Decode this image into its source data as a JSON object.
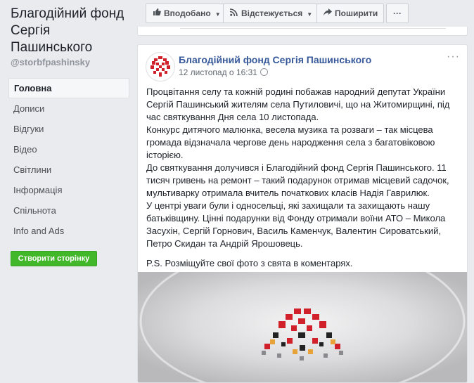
{
  "sidebar": {
    "page_name": "Благодійний фонд Сергія Пашинського",
    "handle": "@storbfpashinsky",
    "items": [
      {
        "label": "Головна"
      },
      {
        "label": "Дописи"
      },
      {
        "label": "Відгуки"
      },
      {
        "label": "Відео"
      },
      {
        "label": "Світлини"
      },
      {
        "label": "Інформація"
      },
      {
        "label": "Спільнота"
      },
      {
        "label": "Info and Ads"
      }
    ],
    "create_page_label": "Створити сторінку"
  },
  "toolbar": {
    "liked_label": "Вподобано",
    "following_label": "Відстежується",
    "share_label": "Поширити",
    "more_label": "···"
  },
  "post": {
    "author": "Благодійний фонд Сергія Пашинського",
    "timestamp": "12 листопад о 16:31",
    "paragraphs": [
      "Процвітання селу та кожній родині побажав народний депутат України Сергій Пашинський жителям села Путиловичі, що на Житомирщині, під час святкування Дня села 10 листопада.",
      "Конкурс дитячого малюнка, весела музика та розваги – так місцева громада відзначала чергове день народження села з багатовіковою історією.",
      "До святкування долучився і Благодійний фонд Сергія Пашинського. 11 тисяч гривень на ремонт – такий подарунок отримав місцевий садочок, мультиварку отримала вчитель початкових класів Надія Гаврилюк.",
      "У центрі уваги були і односельці, які захищали та захищають нашу батьківщину. Цінні подарунки від Фонду отримали воїни АТО – Микола Засухін, Сергій Горнович, Василь Каменчук, Валентин Сироватський, Петро Скидан та Андрій Ярошовець."
    ],
    "ps": "P.S. Розміщуйте свої фото з свята в коментарях.",
    "more_label": "···"
  },
  "colors": {
    "link": "#365899",
    "create_button": "#42b72a",
    "logo_red": "#d0202a"
  }
}
